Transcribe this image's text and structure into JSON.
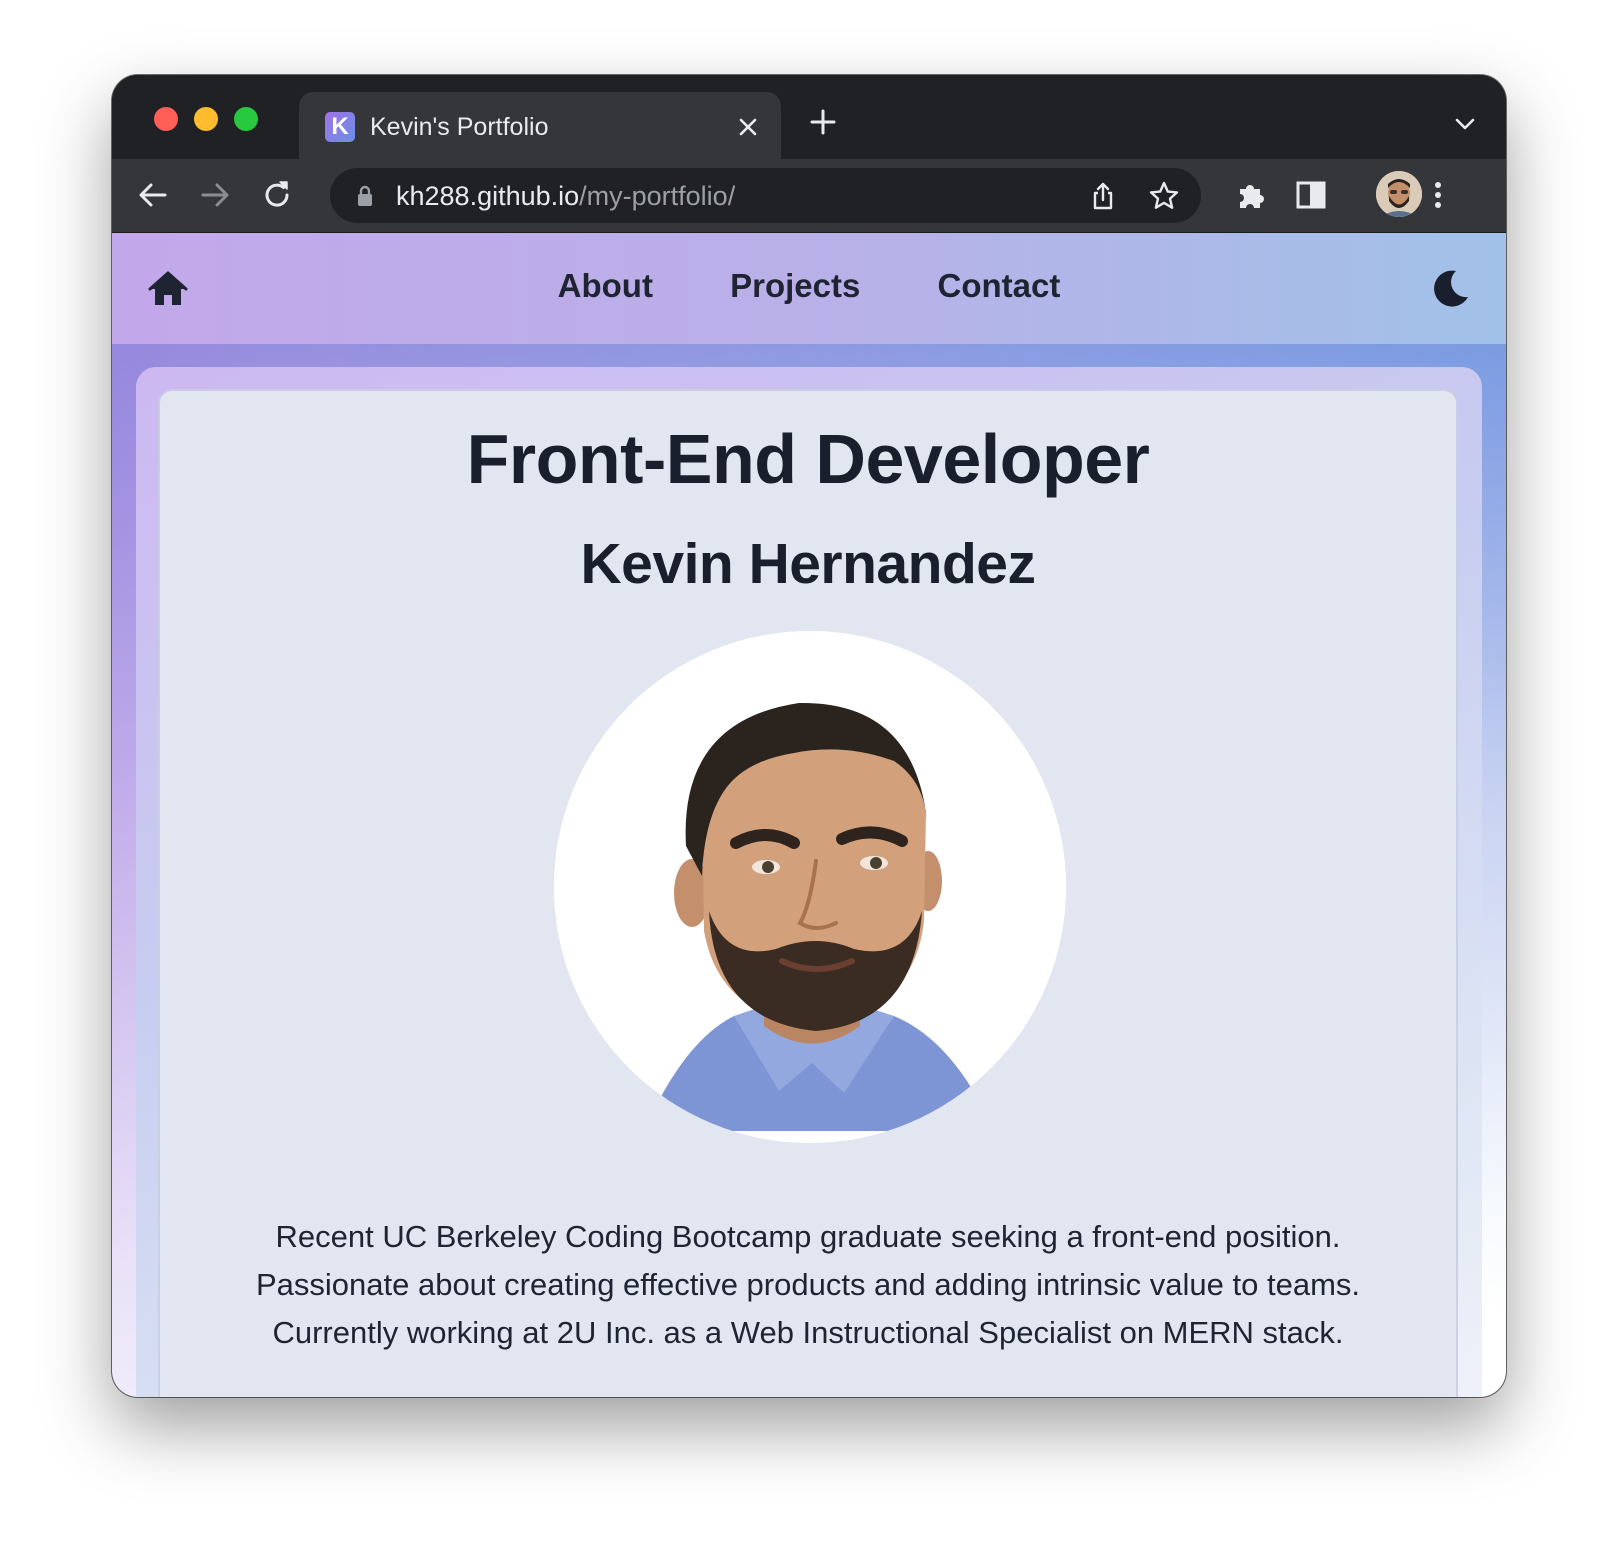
{
  "browser": {
    "tab_title": "Kevin's Portfolio",
    "favicon_letter": "K",
    "url_host": "kh288.github.io",
    "url_path": "/my-portfolio/"
  },
  "nav": {
    "links": [
      "About",
      "Projects",
      "Contact"
    ]
  },
  "hero": {
    "role": "Front-End Developer",
    "name": "Kevin Hernandez",
    "bio_lines": [
      "Recent UC Berkeley Coding Bootcamp graduate seeking a front-end position.",
      "Passionate about creating effective products and adding intrinsic value to teams.",
      "Currently working at 2U Inc. as a Web Instructional Specialist on MERN stack."
    ]
  },
  "colors": {
    "chrome_dark": "#202124",
    "chrome_tab": "#35363a",
    "text_dark": "#1a1f2e",
    "card_bg": "#e2e6f0"
  },
  "icons": [
    "home-icon",
    "moon-icon",
    "back-icon",
    "forward-icon",
    "reload-icon",
    "lock-icon",
    "share-icon",
    "star-icon",
    "extensions-icon",
    "side-panel-icon",
    "more-icon",
    "close-icon",
    "new-tab-icon",
    "tab-search-icon"
  ]
}
